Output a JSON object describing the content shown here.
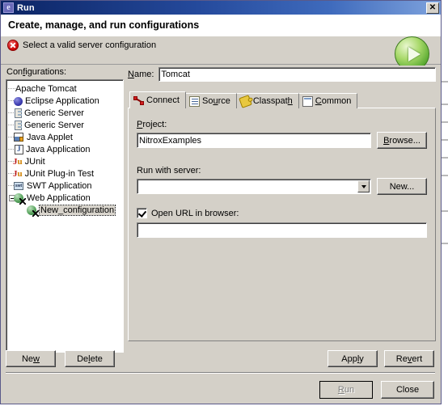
{
  "window": {
    "title": "Run",
    "icon": "eclipse-icon",
    "close_label": "✕"
  },
  "banner": {
    "title": "Create, manage, and run configurations",
    "message": "Select a valid server configuration",
    "message_icon": "error-icon",
    "run_icon": "run-play-icon"
  },
  "left": {
    "label": "Configurations:",
    "label_html": "Con<u>f</u>igurations:",
    "tree": [
      {
        "label": "Apache Tomcat",
        "icon": "tomcat-icon",
        "depth": 0,
        "selected": false,
        "expander": "none"
      },
      {
        "label": "Eclipse Application",
        "icon": "eclipse-application-icon",
        "depth": 0,
        "selected": false,
        "expander": "none"
      },
      {
        "label": "Generic Server",
        "icon": "generic-server-icon",
        "depth": 0,
        "selected": false,
        "expander": "none"
      },
      {
        "label": "Generic Server",
        "icon": "generic-server-icon",
        "depth": 0,
        "selected": false,
        "expander": "none"
      },
      {
        "label": "Java Applet",
        "icon": "java-applet-icon",
        "depth": 0,
        "selected": false,
        "expander": "none"
      },
      {
        "label": "Java Application",
        "icon": "java-application-icon",
        "depth": 0,
        "selected": false,
        "expander": "none"
      },
      {
        "label": "JUnit",
        "icon": "junit-icon",
        "depth": 0,
        "selected": false,
        "expander": "none"
      },
      {
        "label": "JUnit Plug-in Test",
        "icon": "junit-plugin-icon",
        "depth": 0,
        "selected": false,
        "expander": "none"
      },
      {
        "label": "SWT Application",
        "icon": "swt-icon",
        "depth": 0,
        "selected": false,
        "expander": "none"
      },
      {
        "label": "Web Application",
        "icon": "web-application-icon",
        "depth": 0,
        "selected": false,
        "expander": "expanded"
      },
      {
        "label": "New_configuration",
        "icon": "web-application-icon",
        "depth": 1,
        "selected": true,
        "expander": "none"
      }
    ],
    "buttons": {
      "new": "New",
      "new_html": "Ne<u>w</u>",
      "delete": "Delete",
      "delete_html": "De<u>l</u>ete"
    }
  },
  "right": {
    "name_label": "Name:",
    "name_label_html": "<u>N</u>ame:",
    "name_value": "Tomcat",
    "tabs": [
      {
        "label": "Connect",
        "label_html": "Connect",
        "icon": "connect-icon",
        "active": true
      },
      {
        "label": "Source",
        "label_html": "So<u>u</u>rce",
        "icon": "source-icon",
        "active": false
      },
      {
        "label": "Classpath",
        "label_html": "Classpat<u>h</u>",
        "icon": "classpath-icon",
        "active": false
      },
      {
        "label": "Common",
        "label_html": "<u>C</u>ommon",
        "icon": "common-icon",
        "active": false
      }
    ],
    "connect": {
      "project_label": "Project:",
      "project_label_html": "<u>P</u>roject:",
      "project_value": "NitroxExamples",
      "browse_button": "Browse...",
      "browse_button_html": "<u>B</u>rowse...",
      "server_label": "Run with server:",
      "server_value": "",
      "new_button": "New...",
      "new_button_html": "New...",
      "open_url_label": "Open URL in browser:",
      "open_url_checked": true,
      "url_value": ""
    },
    "apply_button": "Apply",
    "apply_button_html": "App<u>l</u>y",
    "revert_button": "Revert",
    "revert_button_html": "Re<u>v</u>ert"
  },
  "footer": {
    "run_button": "Run",
    "run_button_html": "<u>R</u>un",
    "run_enabled": false,
    "close_button": "Close"
  }
}
